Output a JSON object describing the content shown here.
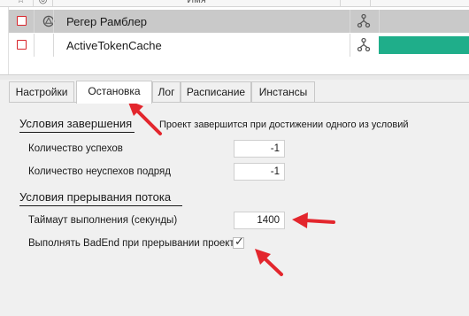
{
  "grid": {
    "header": {
      "name_label": "Имя"
    },
    "rows": [
      {
        "name": "Регер Рамблер",
        "selected": true
      },
      {
        "name": "ActiveTokenCache",
        "selected": false,
        "progress_color": "#1fae8a"
      }
    ]
  },
  "tabs": [
    {
      "label": "Настройки",
      "active": false
    },
    {
      "label": "Остановка",
      "active": true
    },
    {
      "label": "Лог",
      "active": false
    },
    {
      "label": "Расписание",
      "active": false
    },
    {
      "label": "Инстансы",
      "active": false
    }
  ],
  "completion": {
    "title": "Условия завершения",
    "hint": "Проект завершится при достижении одного из условий",
    "success_label": "Количество успехов",
    "success_value": "-1",
    "fail_label": "Количество неуспехов подряд",
    "fail_value": "-1"
  },
  "interrupt": {
    "title": "Условия прерывания потока",
    "timeout_label": "Таймаут выполнения (секунды)",
    "timeout_value": "1400",
    "badend_label": "Выполнять BadEnd при прерывании проекта",
    "badend_checked": true,
    "badend_mark": "✓"
  },
  "colors": {
    "accent_arrow": "#e3262d",
    "progress": "#1fae8a",
    "check_border": "#d8242b"
  }
}
